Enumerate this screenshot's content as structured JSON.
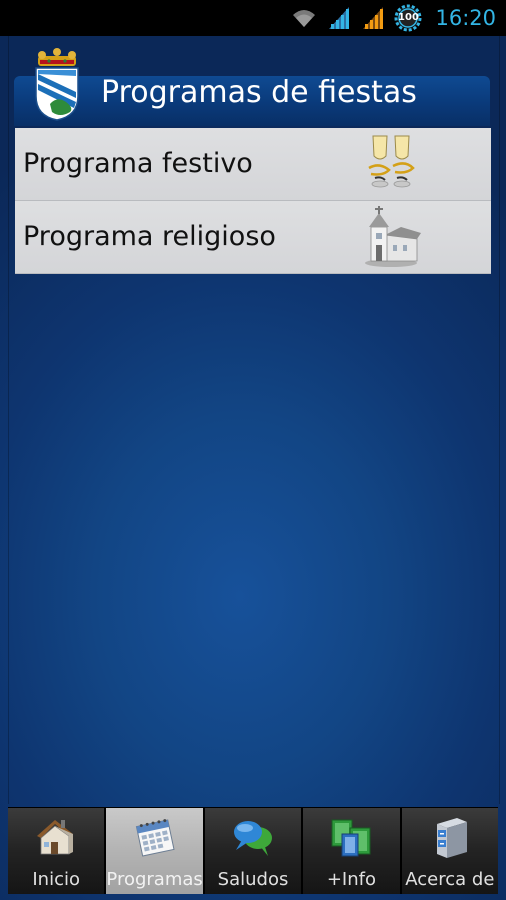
{
  "status_bar": {
    "time": "16:20",
    "battery_level": "100",
    "icons": [
      "wifi-icon",
      "signal-icon",
      "signal-roaming-icon",
      "battery-icon"
    ],
    "accent_color": "#33b5e5"
  },
  "header": {
    "title": "Programas de fiestas",
    "logo": "coat-of-arms-icon"
  },
  "list": {
    "items": [
      {
        "label": "Programa festivo",
        "icon": "champagne-glasses-icon"
      },
      {
        "label": "Programa religioso",
        "icon": "church-icon"
      }
    ]
  },
  "tabs": [
    {
      "label": "Inicio",
      "icon": "house-icon",
      "active": false
    },
    {
      "label": "Programas",
      "icon": "calendar-icon",
      "active": true
    },
    {
      "label": "Saludos",
      "icon": "speech-bubbles-icon",
      "active": false
    },
    {
      "label": "+Info",
      "icon": "windows-icon",
      "active": false
    },
    {
      "label": "Acerca de",
      "icon": "cabinet-icon",
      "active": false
    }
  ]
}
